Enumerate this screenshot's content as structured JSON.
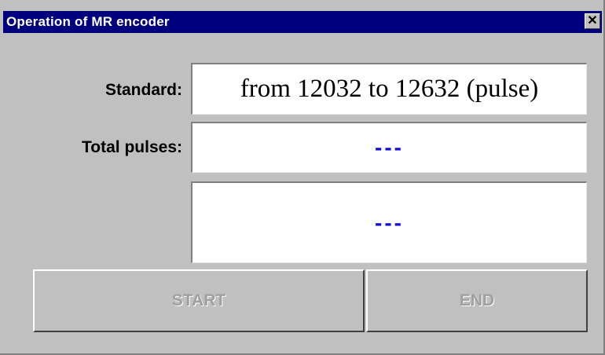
{
  "window": {
    "title": "Operation of MR encoder",
    "close_glyph": "✕"
  },
  "fields": {
    "standard_label": "Standard:",
    "standard_value": "from 12032 to 12632 (pulse)",
    "total_label": "Total pulses:",
    "total_value": "---",
    "result_value": "---"
  },
  "buttons": {
    "start_label": "START",
    "end_label": "END"
  },
  "colors": {
    "titlebar": "#00007f",
    "dialog_bg": "#c0c0c0",
    "value_blue": "#1010d0",
    "disabled_text": "#a0a0a0"
  }
}
